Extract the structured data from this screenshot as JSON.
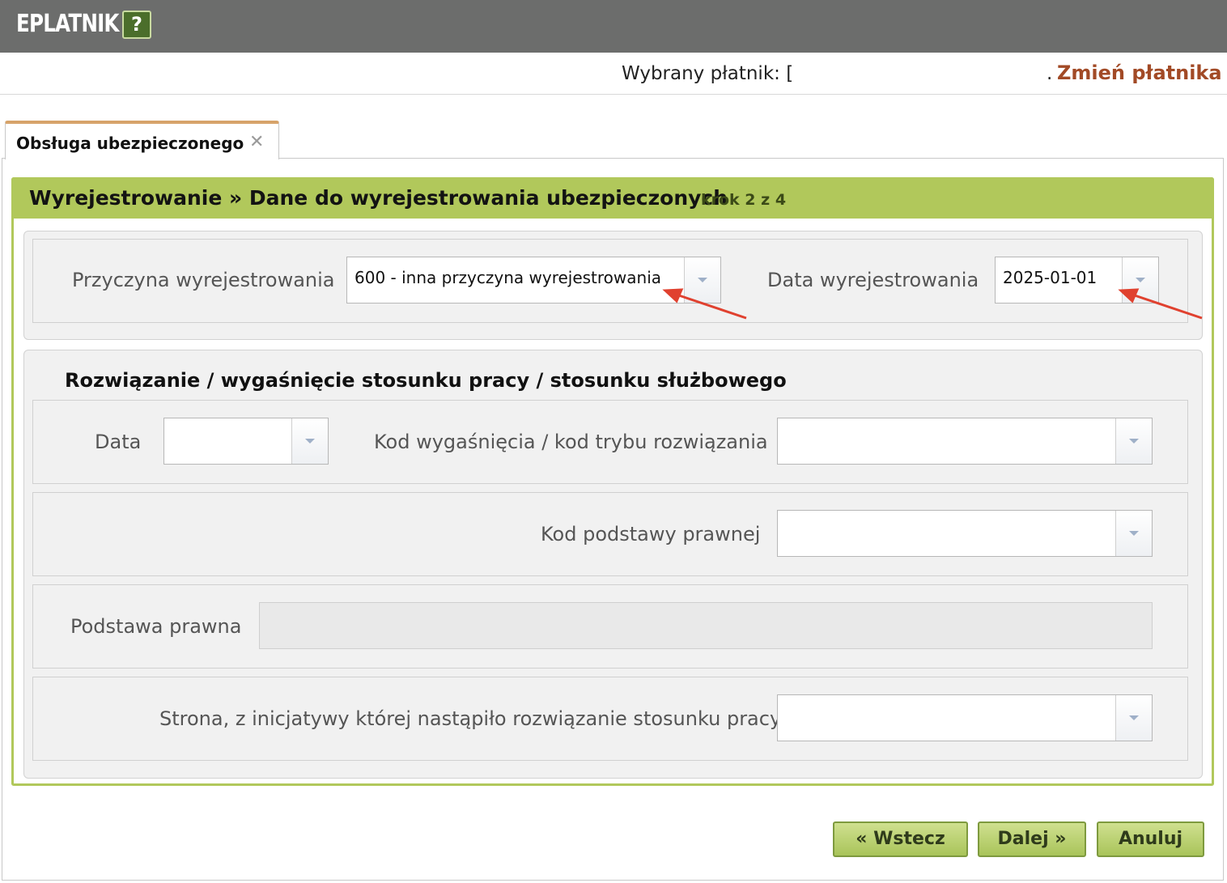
{
  "header": {
    "app_title": "EPLATNIK",
    "help_label": "?"
  },
  "payer": {
    "label": "Wybrany płatnik: [",
    "trailing": ".",
    "change_link": "Zmień płatnika"
  },
  "tabs": [
    {
      "label": "Obsługa ubezpieczonego",
      "close": "x"
    }
  ],
  "wizard": {
    "title": "Wyrejestrowanie » Dane do wyrejestrowania ubezpieczonych",
    "step": "krok 2 z 4"
  },
  "top_form": {
    "reason_label": "Przyczyna wyrejestrowania",
    "reason_value": "600 - inna przyczyna wyrejestrowania",
    "date_label": "Data wyrejestrowania",
    "date_value": "2025-01-01"
  },
  "termination": {
    "title": "Rozwiązanie / wygaśnięcie stosunku pracy / stosunku służbowego",
    "date_label": "Data",
    "date_value": "",
    "code_label": "Kod wygaśnięcia / kod trybu rozwiązania",
    "code_value": "",
    "legal_code_label": "Kod podstawy prawnej",
    "legal_code_value": "",
    "legal_basis_label": "Podstawa prawna",
    "legal_basis_value": "",
    "initiator_label": "Strona, z inicjatywy której nastąpiło rozwiązanie stosunku pracy",
    "initiator_value": ""
  },
  "buttons": {
    "back": "« Wstecz",
    "next": "Dalej »",
    "cancel": "Anuluj"
  },
  "colors": {
    "header_bg": "#6c6d6c",
    "accent_green": "#b1c85b",
    "link_color": "#a24a26",
    "annotation_arrow": "#e0412f"
  },
  "icons": [
    "help-icon",
    "close-icon",
    "dropdown-arrow-icon"
  ]
}
